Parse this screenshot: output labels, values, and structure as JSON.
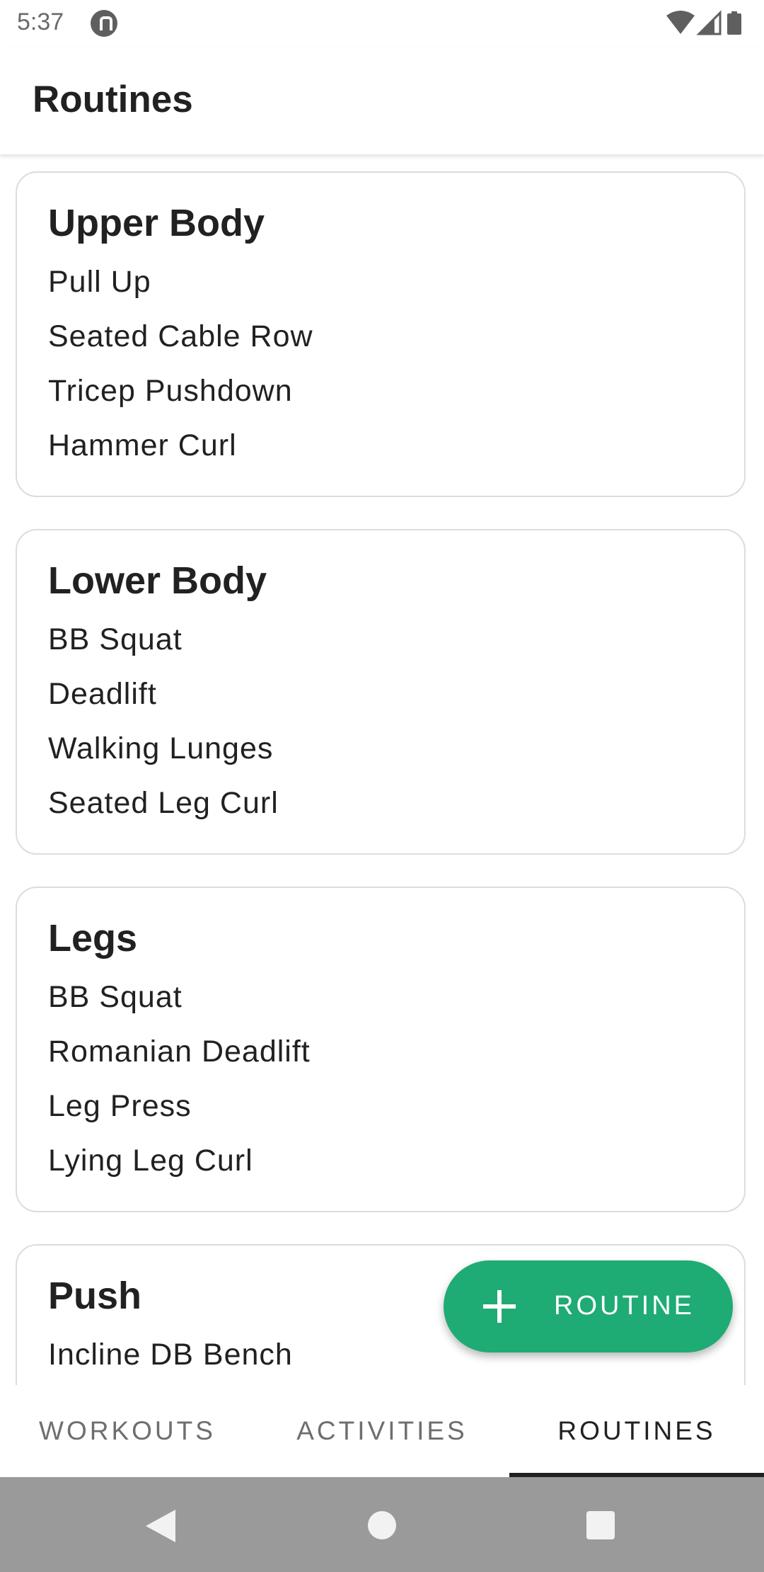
{
  "status_bar": {
    "time": "5:37",
    "icons": [
      "app-notification-icon",
      "wifi-icon",
      "cell-signal-icon",
      "battery-icon"
    ]
  },
  "app_bar": {
    "title": "Routines"
  },
  "routines": [
    {
      "name": "Upper Body",
      "exercises": [
        "Pull Up",
        "Seated Cable Row",
        "Tricep Pushdown",
        "Hammer Curl"
      ]
    },
    {
      "name": "Lower Body",
      "exercises": [
        "BB Squat",
        "Deadlift",
        "Walking Lunges",
        "Seated Leg Curl"
      ]
    },
    {
      "name": "Legs",
      "exercises": [
        "BB Squat",
        "Romanian Deadlift",
        "Leg Press",
        "Lying Leg Curl"
      ]
    },
    {
      "name": "Push",
      "exercises": [
        "Incline DB Bench"
      ]
    }
  ],
  "fab": {
    "label": "ROUTINE",
    "icon": "plus-icon"
  },
  "tabs": [
    {
      "label": "WORKOUTS",
      "active": false
    },
    {
      "label": "ACTIVITIES",
      "active": false
    },
    {
      "label": "ROUTINES",
      "active": true
    }
  ],
  "nav_bar": {
    "icons": [
      "back-icon",
      "home-icon",
      "recents-icon"
    ]
  },
  "colors": {
    "accent": "#1fab74",
    "text_primary": "#212121",
    "text_secondary": "#6e6e6e",
    "nav_bar": "#9a9a9a"
  }
}
